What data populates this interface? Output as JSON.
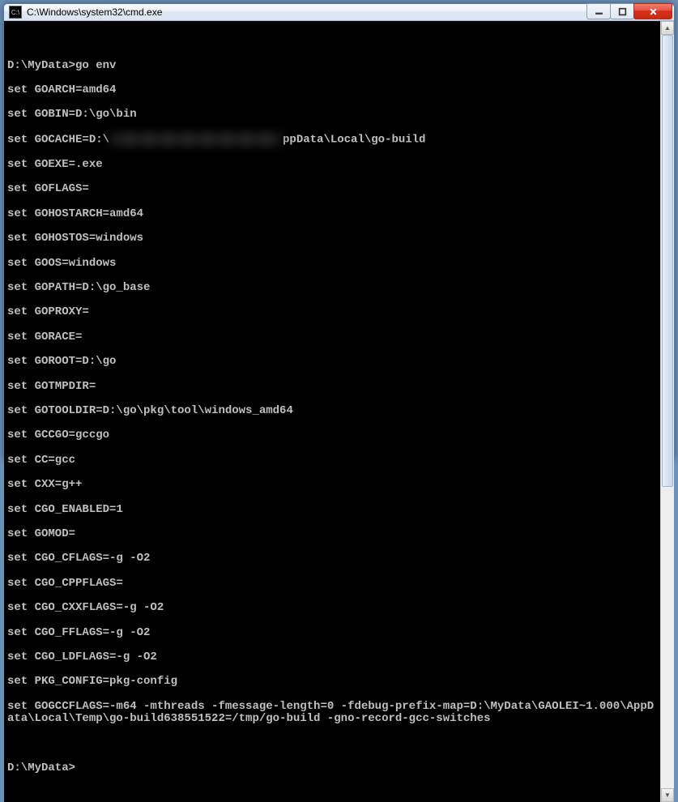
{
  "window": {
    "title": "C:\\Windows\\system32\\cmd.exe",
    "icon_label": "C:\\"
  },
  "buttons": {
    "minimize": "minimize-button",
    "maximize": "maximize-button",
    "close": "close-button"
  },
  "prompt1": {
    "path": "D:\\MyData>",
    "cmd": "go env"
  },
  "env": {
    "l0": "set GOARCH=amd64",
    "l1": "set GOBIN=D:\\go\\bin",
    "l2a": "set GOCACHE=D:\\",
    "l2b": "ppData\\Local\\go-build",
    "l3": "set GOEXE=.exe",
    "l4": "set GOFLAGS=",
    "l5": "set GOHOSTARCH=amd64",
    "l6": "set GOHOSTOS=windows",
    "l7": "set GOOS=windows",
    "l8": "set GOPATH=D:\\go_base",
    "l9": "set GOPROXY=",
    "l10": "set GORACE=",
    "l11": "set GOROOT=D:\\go",
    "l12": "set GOTMPDIR=",
    "l13": "set GOTOOLDIR=D:\\go\\pkg\\tool\\windows_amd64",
    "l14": "set GCCGO=gccgo",
    "l15": "set CC=gcc",
    "l16": "set CXX=g++",
    "l17": "set CGO_ENABLED=1",
    "l18": "set GOMOD=",
    "l19": "set CGO_CFLAGS=-g -O2",
    "l20": "set CGO_CPPFLAGS=",
    "l21": "set CGO_CXXFLAGS=-g -O2",
    "l22": "set CGO_FFLAGS=-g -O2",
    "l23": "set CGO_LDFLAGS=-g -O2",
    "l24": "set PKG_CONFIG=pkg-config",
    "l25": "set GOGCCFLAGS=-m64 -mthreads -fmessage-length=0 -fdebug-prefix-map=D:\\MyData\\GAOLEI~1.000\\AppData\\Local\\Temp\\go-build638551522=/tmp/go-build -gno-record-gcc-switches"
  },
  "prompt2": {
    "path": "D:\\MyData>"
  }
}
